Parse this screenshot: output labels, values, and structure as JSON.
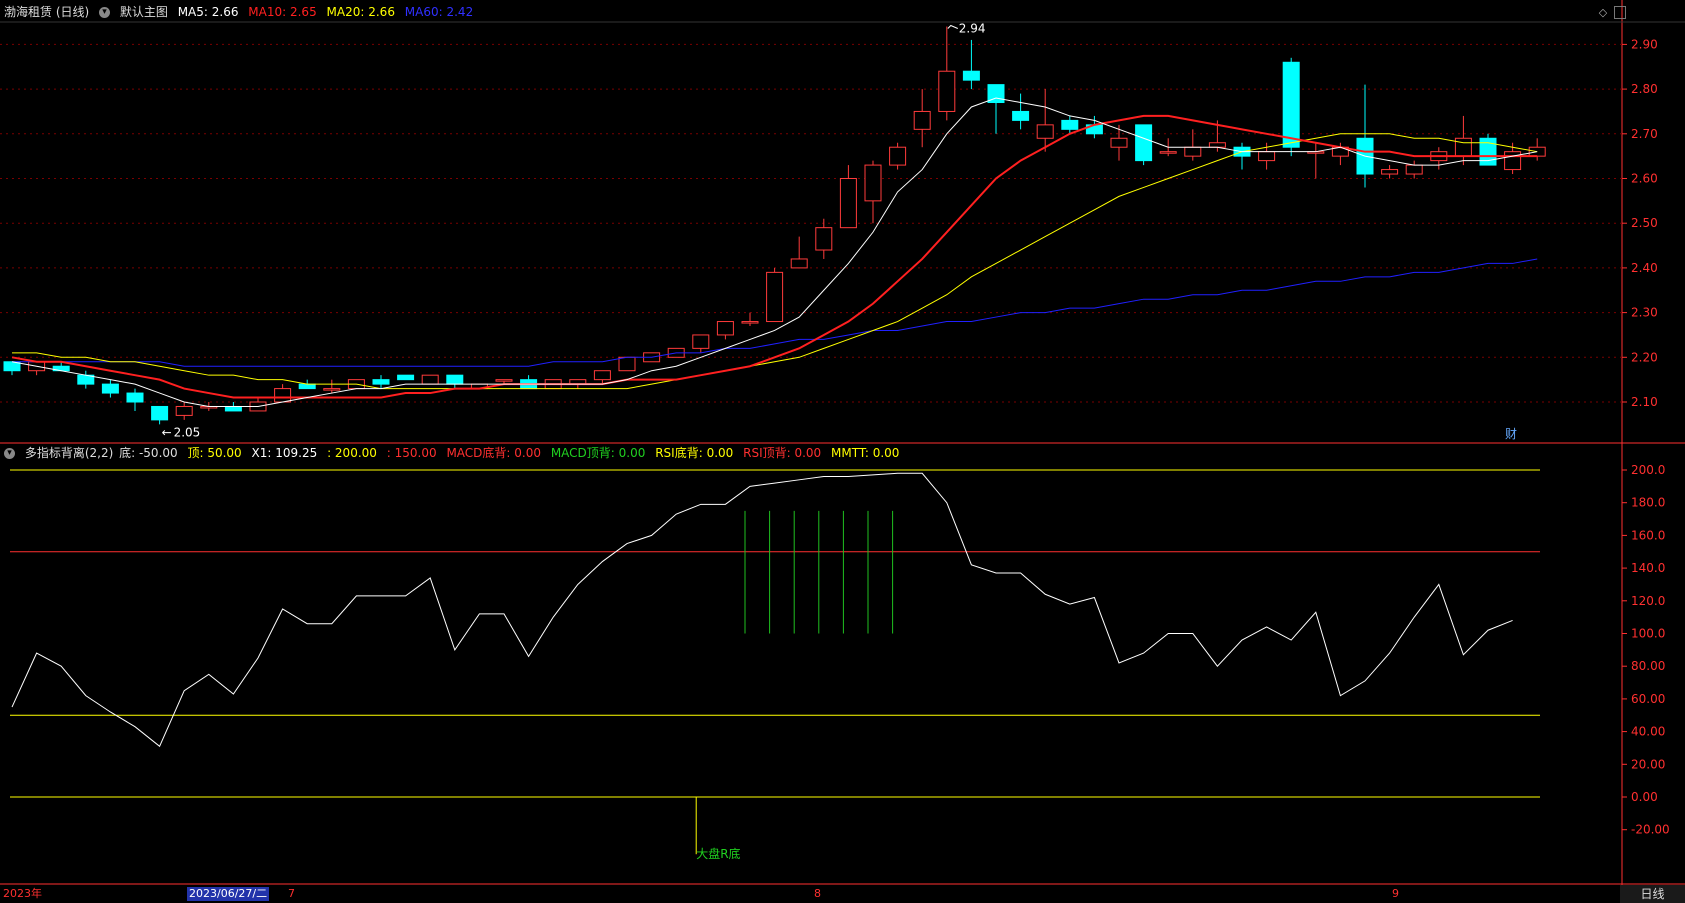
{
  "title": {
    "stock": "渤海租赁 (日线)",
    "main_chart_name": "默认主图",
    "ma5": "MA5: 2.66",
    "ma10": "MA10: 2.65",
    "ma20": "MA20: 2.66",
    "ma60": "MA60: 2.42"
  },
  "indicator": {
    "name": "多指标背离(2,2)",
    "bottom": "底: -50.00",
    "top": "顶: 50.00",
    "x1": "X1: 109.25",
    "v200": ": 200.00",
    "v150": ": 150.00",
    "macd_bottom": "MACD底背: 0.00",
    "macd_top": "MACD顶背: 0.00",
    "rsi_bottom": "RSI底背: 0.00",
    "rsi_top": "RSI顶背: 0.00",
    "mmtt": "MMTT: 0.00",
    "signal_label": "大盘R底"
  },
  "annotations": {
    "high": "2.94",
    "low": "2.05",
    "fin_badge": "财"
  },
  "bottom_bar": {
    "year": "2023年",
    "cursor_date": "2023/06/27/二",
    "m7": "7",
    "m8": "8",
    "m9": "9",
    "cycle": "日线"
  },
  "colors": {
    "up": "#ff3b3b",
    "down": "#00ffff",
    "ma5": "#ffffff",
    "ma10": "#ff2020",
    "ma20": "#ffff00",
    "ma60": "#2020ff",
    "grid": "#7a0000",
    "axis": "#ff3030"
  },
  "chart_data": [
    {
      "type": "candlestick",
      "title": "渤海租赁 (日线)",
      "ylim": [
        2.03,
        2.94
      ],
      "yticks": [
        2.1,
        2.2,
        2.3,
        2.4,
        2.5,
        2.6,
        2.7,
        2.8,
        2.9
      ],
      "candles": [
        [
          2.19,
          2.19,
          2.16,
          2.17
        ],
        [
          2.17,
          2.19,
          2.16,
          2.19
        ],
        [
          2.18,
          2.19,
          2.17,
          2.17
        ],
        [
          2.16,
          2.17,
          2.13,
          2.14
        ],
        [
          2.14,
          2.15,
          2.11,
          2.12
        ],
        [
          2.12,
          2.13,
          2.08,
          2.1
        ],
        [
          2.09,
          2.09,
          2.05,
          2.06
        ],
        [
          2.07,
          2.1,
          2.06,
          2.09
        ],
        [
          2.09,
          2.1,
          2.08,
          2.09
        ],
        [
          2.09,
          2.1,
          2.08,
          2.08
        ],
        [
          2.08,
          2.11,
          2.08,
          2.1
        ],
        [
          2.1,
          2.14,
          2.1,
          2.13
        ],
        [
          2.14,
          2.15,
          2.13,
          2.13
        ],
        [
          2.13,
          2.15,
          2.12,
          2.13
        ],
        [
          2.13,
          2.15,
          2.13,
          2.15
        ],
        [
          2.15,
          2.16,
          2.13,
          2.14
        ],
        [
          2.16,
          2.16,
          2.15,
          2.15
        ],
        [
          2.14,
          2.16,
          2.14,
          2.16
        ],
        [
          2.16,
          2.16,
          2.13,
          2.14
        ],
        [
          2.13,
          2.14,
          2.13,
          2.14
        ],
        [
          2.15,
          2.15,
          2.14,
          2.15
        ],
        [
          2.15,
          2.16,
          2.14,
          2.13
        ],
        [
          2.13,
          2.14,
          2.13,
          2.15
        ],
        [
          2.14,
          2.15,
          2.13,
          2.15
        ],
        [
          2.15,
          2.17,
          2.14,
          2.17
        ],
        [
          2.17,
          2.2,
          2.17,
          2.2
        ],
        [
          2.19,
          2.21,
          2.19,
          2.21
        ],
        [
          2.2,
          2.22,
          2.2,
          2.22
        ],
        [
          2.22,
          2.25,
          2.21,
          2.25
        ],
        [
          2.25,
          2.28,
          2.24,
          2.28
        ],
        [
          2.28,
          2.3,
          2.27,
          2.28
        ],
        [
          2.28,
          2.4,
          2.28,
          2.39
        ],
        [
          2.4,
          2.47,
          2.4,
          2.42
        ],
        [
          2.44,
          2.51,
          2.42,
          2.49
        ],
        [
          2.49,
          2.63,
          2.49,
          2.6
        ],
        [
          2.55,
          2.64,
          2.5,
          2.63
        ],
        [
          2.63,
          2.68,
          2.62,
          2.67
        ],
        [
          2.71,
          2.8,
          2.67,
          2.75
        ],
        [
          2.75,
          2.94,
          2.73,
          2.84
        ],
        [
          2.84,
          2.91,
          2.8,
          2.82
        ],
        [
          2.81,
          2.81,
          2.7,
          2.77
        ],
        [
          2.75,
          2.79,
          2.71,
          2.73
        ],
        [
          2.69,
          2.8,
          2.66,
          2.72
        ],
        [
          2.73,
          2.74,
          2.7,
          2.71
        ],
        [
          2.72,
          2.74,
          2.69,
          2.7
        ],
        [
          2.67,
          2.72,
          2.64,
          2.69
        ],
        [
          2.72,
          2.72,
          2.63,
          2.64
        ],
        [
          2.66,
          2.69,
          2.65,
          2.66
        ],
        [
          2.65,
          2.71,
          2.64,
          2.67
        ],
        [
          2.67,
          2.73,
          2.66,
          2.68
        ],
        [
          2.67,
          2.68,
          2.62,
          2.65
        ],
        [
          2.64,
          2.68,
          2.62,
          2.66
        ],
        [
          2.86,
          2.87,
          2.65,
          2.67
        ],
        [
          2.66,
          2.68,
          2.6,
          2.66
        ],
        [
          2.65,
          2.68,
          2.63,
          2.67
        ],
        [
          2.69,
          2.81,
          2.58,
          2.61
        ],
        [
          2.61,
          2.63,
          2.6,
          2.62
        ],
        [
          2.61,
          2.64,
          2.6,
          2.63
        ],
        [
          2.64,
          2.67,
          2.62,
          2.66
        ],
        [
          2.65,
          2.74,
          2.63,
          2.69
        ],
        [
          2.69,
          2.7,
          2.63,
          2.63
        ],
        [
          2.62,
          2.68,
          2.61,
          2.66
        ],
        [
          2.65,
          2.69,
          2.64,
          2.67
        ]
      ],
      "ma5": [
        2.19,
        2.18,
        2.17,
        2.16,
        2.15,
        2.14,
        2.12,
        2.1,
        2.09,
        2.09,
        2.09,
        2.1,
        2.11,
        2.12,
        2.13,
        2.13,
        2.14,
        2.14,
        2.14,
        2.14,
        2.14,
        2.14,
        2.14,
        2.14,
        2.14,
        2.15,
        2.17,
        2.18,
        2.2,
        2.22,
        2.24,
        2.26,
        2.29,
        2.35,
        2.41,
        2.48,
        2.57,
        2.62,
        2.7,
        2.76,
        2.78,
        2.77,
        2.76,
        2.74,
        2.73,
        2.71,
        2.69,
        2.67,
        2.67,
        2.67,
        2.66,
        2.66,
        2.66,
        2.66,
        2.67,
        2.65,
        2.64,
        2.63,
        2.63,
        2.64,
        2.64,
        2.65,
        2.66
      ],
      "ma10": [
        2.2,
        2.19,
        2.19,
        2.18,
        2.17,
        2.16,
        2.15,
        2.13,
        2.12,
        2.11,
        2.11,
        2.11,
        2.11,
        2.11,
        2.11,
        2.11,
        2.12,
        2.12,
        2.13,
        2.13,
        2.14,
        2.14,
        2.14,
        2.14,
        2.14,
        2.15,
        2.15,
        2.15,
        2.16,
        2.17,
        2.18,
        2.2,
        2.22,
        2.25,
        2.28,
        2.32,
        2.37,
        2.42,
        2.48,
        2.54,
        2.6,
        2.64,
        2.67,
        2.7,
        2.72,
        2.73,
        2.74,
        2.74,
        2.73,
        2.72,
        2.71,
        2.7,
        2.69,
        2.68,
        2.67,
        2.66,
        2.66,
        2.65,
        2.65,
        2.65,
        2.65,
        2.65,
        2.65
      ],
      "ma20": [
        2.21,
        2.21,
        2.2,
        2.2,
        2.19,
        2.19,
        2.18,
        2.17,
        2.16,
        2.16,
        2.15,
        2.15,
        2.14,
        2.14,
        2.14,
        2.13,
        2.13,
        2.13,
        2.13,
        2.13,
        2.13,
        2.13,
        2.13,
        2.13,
        2.13,
        2.13,
        2.14,
        2.15,
        2.16,
        2.17,
        2.18,
        2.19,
        2.2,
        2.22,
        2.24,
        2.26,
        2.28,
        2.31,
        2.34,
        2.38,
        2.41,
        2.44,
        2.47,
        2.5,
        2.53,
        2.56,
        2.58,
        2.6,
        2.62,
        2.64,
        2.66,
        2.67,
        2.68,
        2.69,
        2.7,
        2.7,
        2.7,
        2.69,
        2.69,
        2.68,
        2.68,
        2.67,
        2.66
      ],
      "ma60": [
        2.19,
        2.19,
        2.19,
        2.19,
        2.19,
        2.19,
        2.19,
        2.18,
        2.18,
        2.18,
        2.18,
        2.18,
        2.18,
        2.18,
        2.18,
        2.18,
        2.18,
        2.18,
        2.18,
        2.18,
        2.18,
        2.18,
        2.19,
        2.19,
        2.19,
        2.2,
        2.2,
        2.21,
        2.21,
        2.22,
        2.22,
        2.23,
        2.24,
        2.24,
        2.25,
        2.26,
        2.26,
        2.27,
        2.28,
        2.28,
        2.29,
        2.3,
        2.3,
        2.31,
        2.31,
        2.32,
        2.33,
        2.33,
        2.34,
        2.34,
        2.35,
        2.35,
        2.36,
        2.37,
        2.37,
        2.38,
        2.38,
        2.39,
        2.39,
        2.4,
        2.41,
        2.41,
        2.42
      ]
    },
    {
      "type": "line",
      "title": "多指标背离(2,2)",
      "ylim": [
        -35,
        205
      ],
      "yticks": [
        "200.0",
        "180.0",
        "160.0",
        "140.0",
        "120.0",
        "100.0",
        "80.00",
        "60.00",
        "40.00",
        "20.00",
        "0.00",
        "-20.00"
      ],
      "yticks_values": [
        200,
        180,
        160,
        140,
        120,
        100,
        80,
        60,
        40,
        20,
        0,
        -20
      ],
      "hlines": [
        200,
        150,
        50,
        0
      ],
      "x1": [
        55,
        88,
        80,
        62,
        52,
        43,
        31,
        65,
        75,
        63,
        85,
        115,
        106,
        106,
        123,
        123,
        123,
        134,
        90,
        112,
        112,
        86,
        110,
        130,
        144,
        155,
        160,
        173,
        179,
        179,
        190,
        192,
        194,
        196,
        196,
        197,
        198,
        198,
        180,
        142,
        137,
        137,
        124,
        118,
        122,
        82,
        88,
        100,
        100,
        80,
        96,
        104,
        96,
        113,
        62,
        71,
        88,
        110,
        130,
        87,
        102,
        108
      ],
      "signal_bars": {
        "indices": [
          30,
          31,
          32,
          33,
          34,
          35,
          36
        ],
        "from": 100,
        "to": 175
      },
      "bottom_signal_index": 27
    }
  ]
}
